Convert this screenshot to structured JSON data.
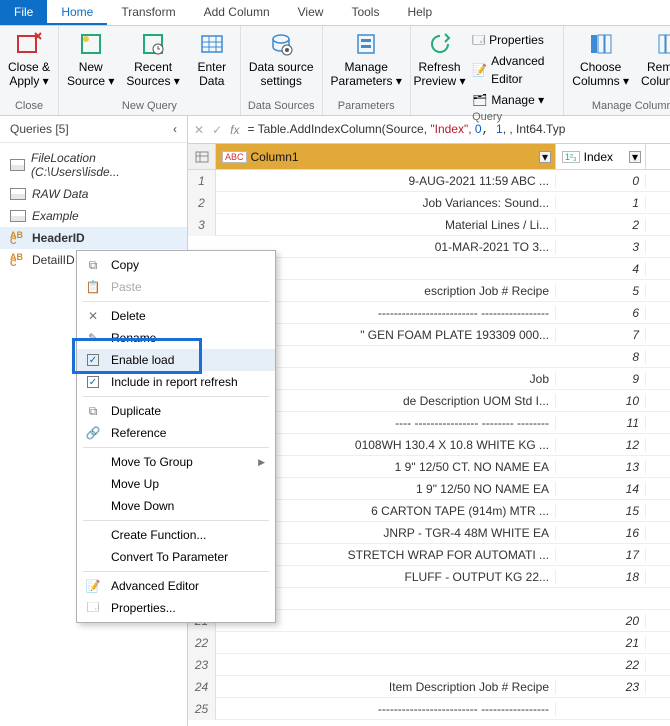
{
  "menu": {
    "file": "File",
    "home": "Home",
    "transform": "Transform",
    "addcol": "Add Column",
    "view": "View",
    "tools": "Tools",
    "help": "Help"
  },
  "ribbon": {
    "close_apply": "Close &\nApply ▾",
    "close": "Close",
    "new_source": "New\nSource ▾",
    "recent_sources": "Recent\nSources ▾",
    "enter_data": "Enter\nData",
    "new_query": "New Query",
    "data_source_settings": "Data source\nsettings",
    "data_sources": "Data Sources",
    "manage_params": "Manage\nParameters ▾",
    "params_group": "Parameters",
    "refresh_preview": "Refresh\nPreview ▾",
    "properties": "Properties",
    "adv_editor": "Advanced Editor",
    "manage": "Manage ▾",
    "query_group": "Query",
    "choose_cols": "Choose\nColumns ▾",
    "remove_cols": "Remove\nColumns ▾",
    "manage_cols": "Manage Columns"
  },
  "formula": {
    "prefix": "= Table.AddIndexColumn(Source, ",
    "str": "\"Index\"",
    "mid": ", ",
    "n1": "0",
    "n2": "1",
    "suffix": ", Int64.Typ"
  },
  "queries": {
    "title": "Queries [5]",
    "items": [
      {
        "label": "FileLocation (C:\\Users\\lisde...",
        "italic": true
      },
      {
        "label": "RAW Data",
        "italic": true
      },
      {
        "label": "Example",
        "italic": true
      },
      {
        "label": "HeaderID",
        "selected": true
      },
      {
        "label": "DetailID"
      }
    ]
  },
  "grid": {
    "col1_label": "Column1",
    "col2_label": "Index",
    "type1": "ABC",
    "type2": "1²₃",
    "rows": [
      {
        "n": 1,
        "c1": "9-AUG-2021 11:59                              ABC ...",
        "c2": "0"
      },
      {
        "n": 2,
        "c1": "Job Variances: Sound...",
        "c2": "1"
      },
      {
        "n": 3,
        "c1": "Material Lines / Li...",
        "c2": "2"
      },
      {
        "n": "",
        "c1": "01-MAR-2021 TO 3...",
        "c2": "3"
      },
      {
        "n": "",
        "c1": "",
        "c2": "4"
      },
      {
        "n": "",
        "c1": "escription      Job #  Recipe",
        "c2": "5"
      },
      {
        "n": "",
        "c1": "------------------------- -----------------",
        "c2": "6"
      },
      {
        "n": "",
        "c1": "\" GEN FOAM PLATE    193309 000...",
        "c2": "7"
      },
      {
        "n": "",
        "c1": "",
        "c2": "8"
      },
      {
        "n": "",
        "c1": "Job",
        "c2": "9"
      },
      {
        "n": "",
        "c1": "de   Description        UOM   Std I...",
        "c2": "10"
      },
      {
        "n": "",
        "c1": "---- ---------------- -------- --------",
        "c2": "11"
      },
      {
        "n": "",
        "c1": "0108WH  130.4 X 10.8    WHITE KG ...",
        "c2": "12"
      },
      {
        "n": "",
        "c1": "1    9\" 12/50 CT. NO NAME    EA",
        "c2": "13"
      },
      {
        "n": "",
        "c1": "1    9\" 12/50 NO NAME    EA",
        "c2": "14"
      },
      {
        "n": "",
        "c1": "6    CARTON TAPE (914m)    MTR ...",
        "c2": "15"
      },
      {
        "n": "",
        "c1": "JNRP - TGR-4 48M WHITE   EA",
        "c2": "16"
      },
      {
        "n": "",
        "c1": "STRETCH WRAP FOR AUTOMATI ...",
        "c2": "17"
      },
      {
        "n": "",
        "c1": "FLUFF - OUTPUT       KG    22...",
        "c2": "18"
      },
      {
        "n": 20,
        "c1": "",
        "c2": ""
      },
      {
        "n": 21,
        "c1": "",
        "c2": "20"
      },
      {
        "n": 22,
        "c1": "",
        "c2": "21"
      },
      {
        "n": 23,
        "c1": "",
        "c2": "22"
      },
      {
        "n": 24,
        "c1": "Item   Description       Job #  Recipe",
        "c2": "23"
      },
      {
        "n": 25,
        "c1": "------------------------- -----------------",
        "c2": ""
      }
    ]
  },
  "cm": {
    "copy": "Copy",
    "paste": "Paste",
    "delete": "Delete",
    "rename": "Rename",
    "enable_load": "Enable load",
    "include_refresh": "Include in report refresh",
    "duplicate": "Duplicate",
    "reference": "Reference",
    "move_group": "Move To Group",
    "move_up": "Move Up",
    "move_down": "Move Down",
    "create_fn": "Create Function...",
    "convert_param": "Convert To Parameter",
    "adv_editor": "Advanced Editor",
    "properties": "Properties..."
  }
}
